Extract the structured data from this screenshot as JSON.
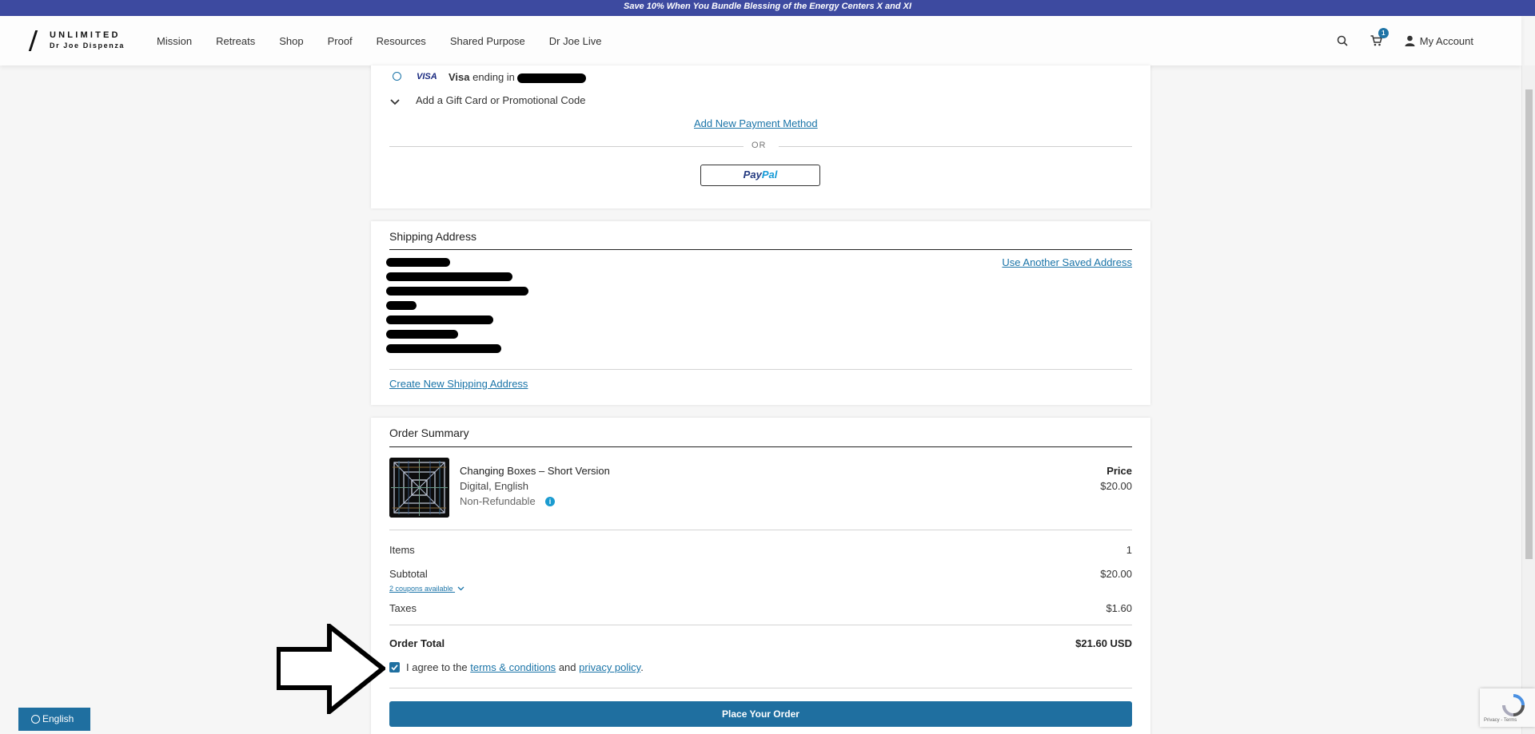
{
  "promo": {
    "text": "Save 10% When You Bundle Blessing of the Energy Centers X and XI"
  },
  "header": {
    "logo_line1": "UNLIMITED",
    "logo_line2": "Dr Joe Dispenza",
    "nav": [
      "Mission",
      "Retreats",
      "Shop",
      "Proof",
      "Resources",
      "Shared Purpose",
      "Dr Joe Live"
    ],
    "cart_count": "1",
    "account_label": "My Account"
  },
  "payment": {
    "visa_logo": "VISA",
    "visa_brand": "Visa",
    "visa_ending": "ending in",
    "gift_label": "Add a Gift Card or Promotional Code",
    "add_method": "Add New Payment Method",
    "or": "OR",
    "paypal_1": "Pay",
    "paypal_2": "Pal"
  },
  "shipping": {
    "title": "Shipping Address",
    "use_another": "Use Another Saved Address",
    "create_new": "Create New Shipping Address"
  },
  "order": {
    "title": "Order Summary",
    "product": {
      "name": "Changing Boxes – Short Version",
      "format": "Digital, English",
      "refund": "Non-Refundable",
      "price_label": "Price",
      "price": "$20.00"
    },
    "items_label": "Items",
    "items_value": "1",
    "subtotal_label": "Subtotal",
    "subtotal_value": "$20.00",
    "coupons": "2 coupons available",
    "taxes_label": "Taxes",
    "taxes_value": "$1.60",
    "total_label": "Order Total",
    "total_value": "$21.60 USD",
    "agree_prefix": "I agree to the",
    "terms": "terms & conditions",
    "and": "and",
    "privacy": "privacy policy",
    "period": ".",
    "place_order": "Place Your Order",
    "terms_checked": true
  },
  "language": {
    "label": "English"
  },
  "recaptcha": {
    "text": "Privacy - Terms"
  },
  "colors": {
    "accent": "#1f6fa0",
    "promo": "#3d4aa0",
    "link": "#1a74a8"
  }
}
